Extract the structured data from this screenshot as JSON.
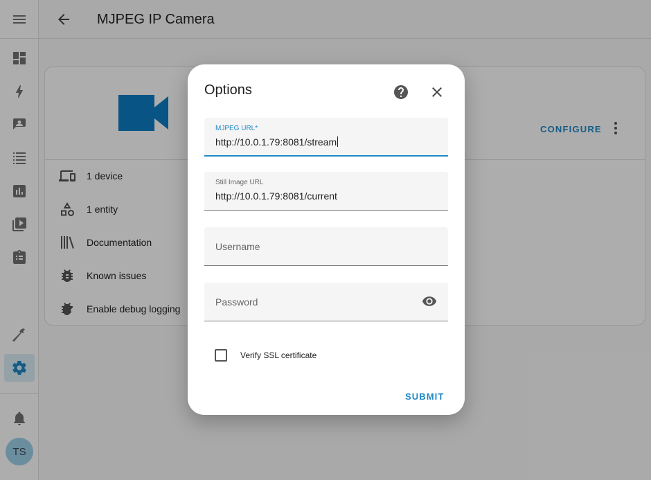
{
  "header": {
    "title": "MJPEG IP Camera"
  },
  "sidebar": {
    "items": [
      {
        "icon": "menu-icon"
      },
      {
        "icon": "dashboard-icon"
      },
      {
        "icon": "energy-icon"
      },
      {
        "icon": "map-icon"
      },
      {
        "icon": "logbook-icon"
      },
      {
        "icon": "history-icon"
      },
      {
        "icon": "media-icon"
      },
      {
        "icon": "todo-icon"
      },
      {
        "icon": "developer-tools-icon"
      },
      {
        "icon": "settings-icon",
        "active": true
      },
      {
        "icon": "notifications-icon"
      }
    ],
    "avatar_initials": "TS"
  },
  "card": {
    "configure_label": "CONFIGURE",
    "rows": [
      {
        "icon": "devices-icon",
        "label": "1 device"
      },
      {
        "icon": "entities-icon",
        "label": "1 entity"
      },
      {
        "icon": "documentation-icon",
        "label": "Documentation"
      },
      {
        "icon": "bug-icon",
        "label": "Known issues"
      },
      {
        "icon": "debug-icon",
        "label": "Enable debug logging"
      }
    ]
  },
  "dialog": {
    "title": "Options",
    "fields": {
      "mjpeg_url": {
        "label": "MJPEG URL*",
        "value": "http://10.0.1.79:8081/stream"
      },
      "still_image_url": {
        "label": "Still Image URL",
        "value": "http://10.0.1.79:8081/current"
      },
      "username": {
        "placeholder": "Username",
        "value": ""
      },
      "password": {
        "placeholder": "Password",
        "value": ""
      }
    },
    "verify_ssl": {
      "label": "Verify SSL certificate",
      "checked": false
    },
    "submit_label": "SUBMIT"
  },
  "colors": {
    "accent": "#1e88c4",
    "camera_icon": "#0d7dc3",
    "avatar_bg": "#9ed1ea"
  }
}
